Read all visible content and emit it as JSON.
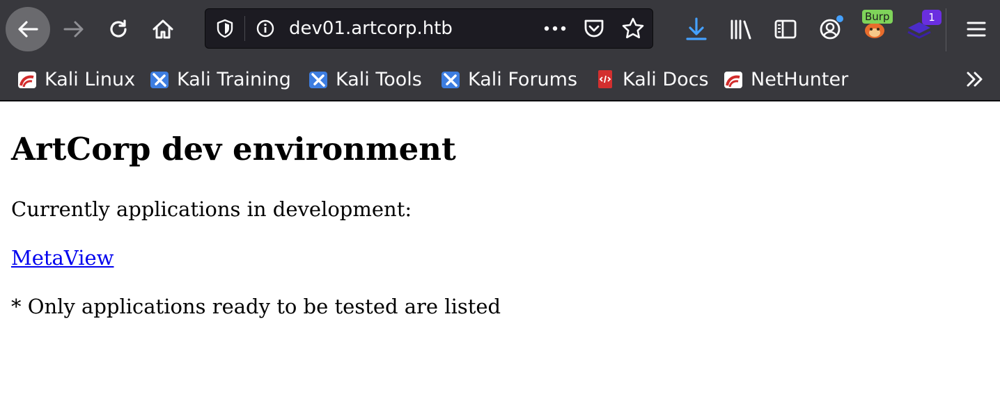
{
  "browser": {
    "url": "dev01.artcorp.htb",
    "extensions": {
      "burp_badge": "Burp",
      "count_badge": "1"
    },
    "bookmarks": [
      {
        "label": "Kali Linux",
        "icon": "kali-linux-icon"
      },
      {
        "label": "Kali Training",
        "icon": "kali-training-icon"
      },
      {
        "label": "Kali Tools",
        "icon": "kali-tools-icon"
      },
      {
        "label": "Kali Forums",
        "icon": "kali-forums-icon"
      },
      {
        "label": "Kali Docs",
        "icon": "kali-docs-icon"
      },
      {
        "label": "NetHunter",
        "icon": "nethunter-icon"
      }
    ],
    "colors": {
      "chrome_bg": "#38383d",
      "urlbar_bg": "#1c1b22",
      "accent_blue": "#45a1ff",
      "link": "#0000ee"
    }
  },
  "page": {
    "heading": "ArtCorp dev environment",
    "intro": "Currently applications in development:",
    "app_link": "MetaView",
    "note": "* Only applications ready to be tested are listed"
  }
}
